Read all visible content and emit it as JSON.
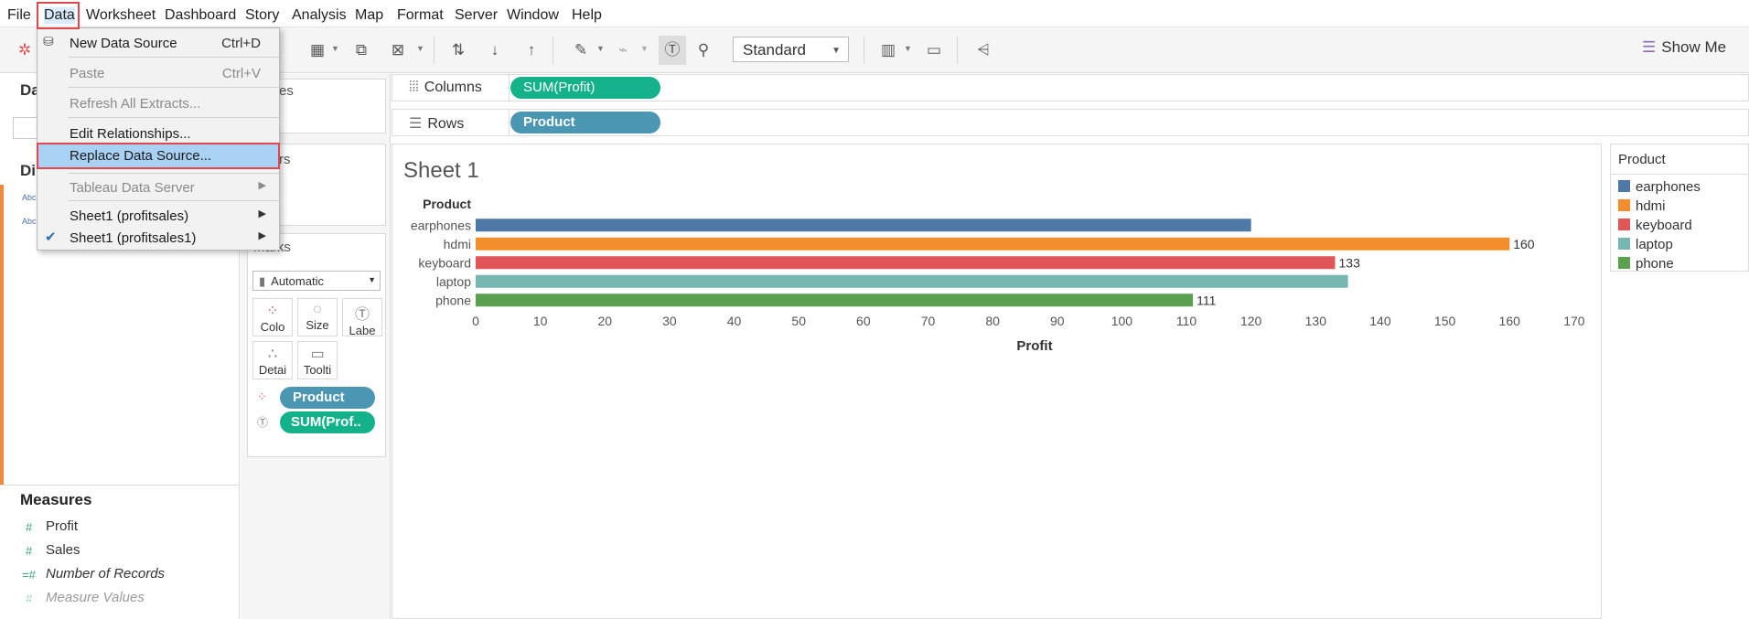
{
  "menubar": {
    "items": [
      "File",
      "Data",
      "Worksheet",
      "Dashboard",
      "Story",
      "Analysis",
      "Map",
      "Format",
      "Server",
      "Window",
      "Help"
    ]
  },
  "toolbar": {
    "fit_value": "Standard",
    "show_me_label": "Show Me"
  },
  "data_menu": {
    "items": [
      {
        "label": "New Data Source",
        "shortcut": "Ctrl+D",
        "enabled": true
      },
      {
        "label": "Paste",
        "shortcut": "Ctrl+V",
        "enabled": false
      },
      {
        "label": "Refresh All Extracts...",
        "enabled": false
      },
      {
        "label": "Edit Relationships...",
        "enabled": true
      },
      {
        "label": "Replace Data Source...",
        "enabled": true,
        "highlighted": true
      },
      {
        "label": "Tableau Data Server",
        "enabled": false,
        "submenu": true
      },
      {
        "label": "Sheet1 (profitsales)",
        "enabled": true,
        "submenu": true
      },
      {
        "label": "Sheet1 (profitsales1)",
        "enabled": true,
        "submenu": true,
        "checked": true
      }
    ]
  },
  "data_pane": {
    "partial_header": "Da",
    "partial_dimensions": "Di",
    "partial_field_1": "Abc",
    "partial_field_2": "Abc",
    "measures_header": "Measures",
    "measures": [
      "Profit",
      "Sales",
      "Number of Records",
      "Measure Values"
    ]
  },
  "shelves": {
    "partial_pages": "es",
    "partial_filters": "rs",
    "columns_label": "Columns",
    "rows_label": "Rows",
    "columns_pill": "SUM(Profit)",
    "rows_pill": "Product"
  },
  "marks": {
    "title": "Marks",
    "type": "Automatic",
    "buttons": [
      "Colo",
      "Size",
      "Labe",
      "Detai",
      "Toolti"
    ],
    "pills": [
      "Product",
      "SUM(Prof.."
    ]
  },
  "legend": {
    "title": "Product",
    "items": [
      {
        "label": "earphones",
        "color": "#4e79a7"
      },
      {
        "label": "hdmi",
        "color": "#f28e2b"
      },
      {
        "label": "keyboard",
        "color": "#e15759"
      },
      {
        "label": "laptop",
        "color": "#76b7b2"
      },
      {
        "label": "phone",
        "color": "#59a14f"
      }
    ]
  },
  "chart_data": {
    "type": "bar",
    "title": "Sheet 1",
    "orientation": "horizontal",
    "row_header": "Product",
    "categories": [
      "earphones",
      "hdmi",
      "keyboard",
      "laptop",
      "phone"
    ],
    "values": [
      120,
      160,
      133,
      135,
      111
    ],
    "data_labels": [
      null,
      "160",
      "133",
      null,
      "111"
    ],
    "colors": [
      "#4e79a7",
      "#f28e2b",
      "#e15759",
      "#76b7b2",
      "#59a14f"
    ],
    "xlabel": "Profit",
    "xlim": [
      0,
      172
    ],
    "xticks": [
      0,
      10,
      20,
      30,
      40,
      50,
      60,
      70,
      80,
      90,
      100,
      110,
      120,
      130,
      140,
      150,
      160,
      170
    ]
  }
}
